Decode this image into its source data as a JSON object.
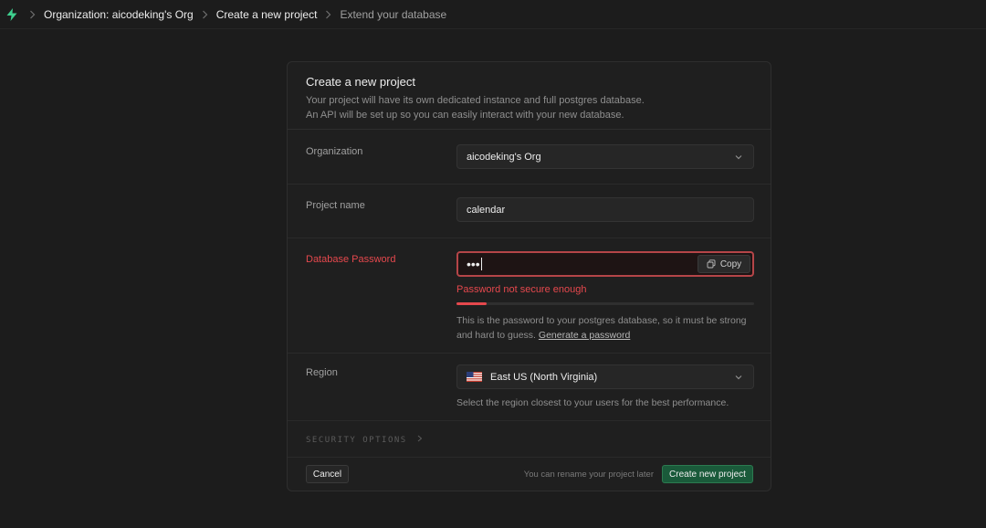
{
  "breadcrumb": {
    "items": [
      "Organization: aicodeking's Org",
      "Create a new project",
      "Extend your database"
    ]
  },
  "card": {
    "title": "Create a new project",
    "description_line1": "Your project will have its own dedicated instance and full postgres database.",
    "description_line2": "An API will be set up so you can easily interact with your new database."
  },
  "organization": {
    "label": "Organization",
    "value": "aicodeking's Org"
  },
  "project_name": {
    "label": "Project name",
    "value": "calendar"
  },
  "password": {
    "label": "Database Password",
    "masked_value": "•••",
    "copy_label": "Copy",
    "error": "Password not secure enough",
    "strength": 0.1,
    "help_text": "This is the password to your postgres database, so it must be strong and hard to guess.",
    "generate_link": "Generate a password"
  },
  "region": {
    "label": "Region",
    "value": "East US (North Virginia)",
    "flag_icon": "us-flag-icon",
    "help": "Select the region closest to your users for the best performance."
  },
  "security_options": {
    "label": "SECURITY OPTIONS"
  },
  "footer": {
    "cancel_label": "Cancel",
    "rename_note": "You can rename your project later",
    "create_label": "Create new project"
  },
  "colors": {
    "accent_green": "#3ecf8e",
    "error_red": "#e5484d",
    "create_button": "#1a5a3a"
  }
}
